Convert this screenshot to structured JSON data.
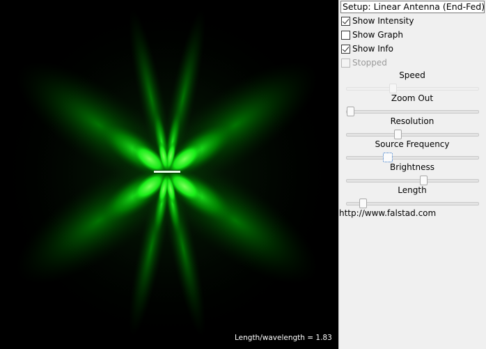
{
  "setup": {
    "selected": "Setup: Linear Antenna (End-Fed)"
  },
  "checkboxes": [
    {
      "label": "Show Intensity",
      "checked": true,
      "enabled": true
    },
    {
      "label": "Show Graph",
      "checked": false,
      "enabled": true
    },
    {
      "label": "Show Info",
      "checked": true,
      "enabled": true
    },
    {
      "label": "Stopped",
      "checked": false,
      "enabled": false
    }
  ],
  "sliders": [
    {
      "label": "Speed",
      "fraction": 0.34
    },
    {
      "label": "Zoom Out",
      "fraction": 0.0
    },
    {
      "label": "Resolution",
      "fraction": 0.38
    },
    {
      "label": "Source Frequency",
      "fraction": 0.29
    },
    {
      "label": "Brightness",
      "fraction": 0.59
    },
    {
      "label": "Length",
      "fraction": 0.1
    }
  ],
  "url": "http://www.falstad.com",
  "info": {
    "text": "Length/wavelength = 1.83"
  },
  "colors": {
    "field": "#00ff00",
    "background": "#000000",
    "panel": "#f0f0f0"
  }
}
